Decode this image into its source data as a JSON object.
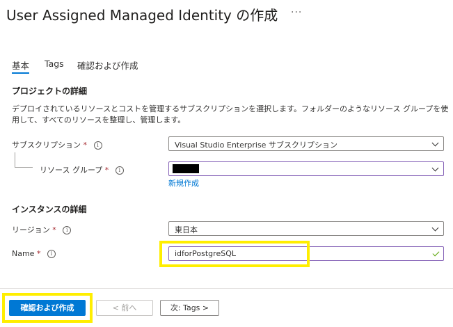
{
  "header": {
    "title": "User Assigned Managed Identity の作成",
    "more_label": "···"
  },
  "tabs": [
    {
      "label": "基本",
      "active": true
    },
    {
      "label": "Tags"
    },
    {
      "label": "確認および作成"
    }
  ],
  "project": {
    "heading": "プロジェクトの詳細",
    "description": "デプロイされているリソースとコストを管理するサブスクリプションを選択します。フォルダーのようなリソース グループを使用して、すべてのリソースを整理し、管理します。",
    "subscription": {
      "label": "サブスクリプション",
      "required": "*",
      "value": "Visual Studio Enterprise サブスクリプション"
    },
    "resource_group": {
      "label": "リソース グループ",
      "required": "*",
      "create_new_link": "新規作成"
    }
  },
  "instance": {
    "heading": "インスタンスの詳細",
    "region": {
      "label": "リージョン",
      "required": "*",
      "value": "東日本"
    },
    "name": {
      "label": "Name",
      "required": "*",
      "value": "idforPostgreSQL"
    }
  },
  "footer": {
    "review_create_label": "確認および作成",
    "prev_label": "< 前へ",
    "next_label": "次: Tags >"
  },
  "icons": {
    "info": "i"
  },
  "colors": {
    "accent": "#0078d4",
    "highlight": "#ffee00",
    "required": "#a4262c",
    "valid": "#57a300"
  }
}
